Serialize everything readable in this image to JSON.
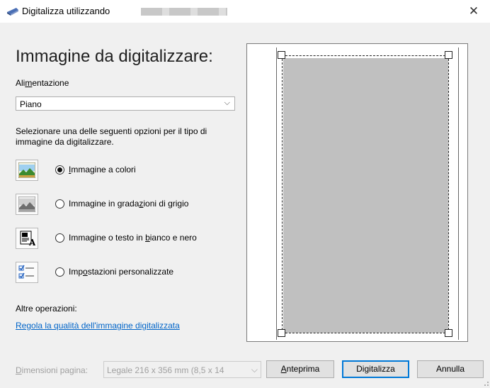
{
  "window": {
    "title": "Digitalizza utilizzando",
    "close_glyph": "✕",
    "icon": "scanner-icon"
  },
  "left": {
    "heading": "Immagine da digitalizzare:",
    "feed_label_pre": "Ali",
    "feed_label_ul": "m",
    "feed_label_post": "entazione",
    "feed_value": "Piano",
    "chevron": "⌵",
    "instruction_line1": "Selezionare una delle seguenti opzioni per il tipo di",
    "instruction_line2": "immagine da digitalizzare.",
    "options": [
      {
        "pre": "",
        "ul": "I",
        "post": "mmagine a colori",
        "selected": true,
        "icon": "color-picture-icon"
      },
      {
        "pre": "Immagine in grada",
        "ul": "z",
        "post": "ioni di grigio",
        "selected": false,
        "icon": "grayscale-picture-icon"
      },
      {
        "pre": "Immagine o testo in ",
        "ul": "b",
        "post": "ianco e nero",
        "selected": false,
        "icon": "black-white-text-icon"
      },
      {
        "pre": "Imp",
        "ul": "o",
        "post": "stazioni personalizzate",
        "selected": false,
        "icon": "custom-settings-icon"
      }
    ],
    "other_ops_label": "Altre operazioni:",
    "quality_link": "Regola la qualità dell'immagine digitalizzata"
  },
  "footer": {
    "page_size_label_ul": "D",
    "page_size_label_post": "imensioni pagina:",
    "page_size_value": "Legale 216 x 356 mm (8,5 x 14",
    "preview_ul": "A",
    "preview_post": "nteprima",
    "scan_pre": "Di",
    "scan_ul": "g",
    "scan_post": "italizza",
    "cancel": "Annulla"
  }
}
